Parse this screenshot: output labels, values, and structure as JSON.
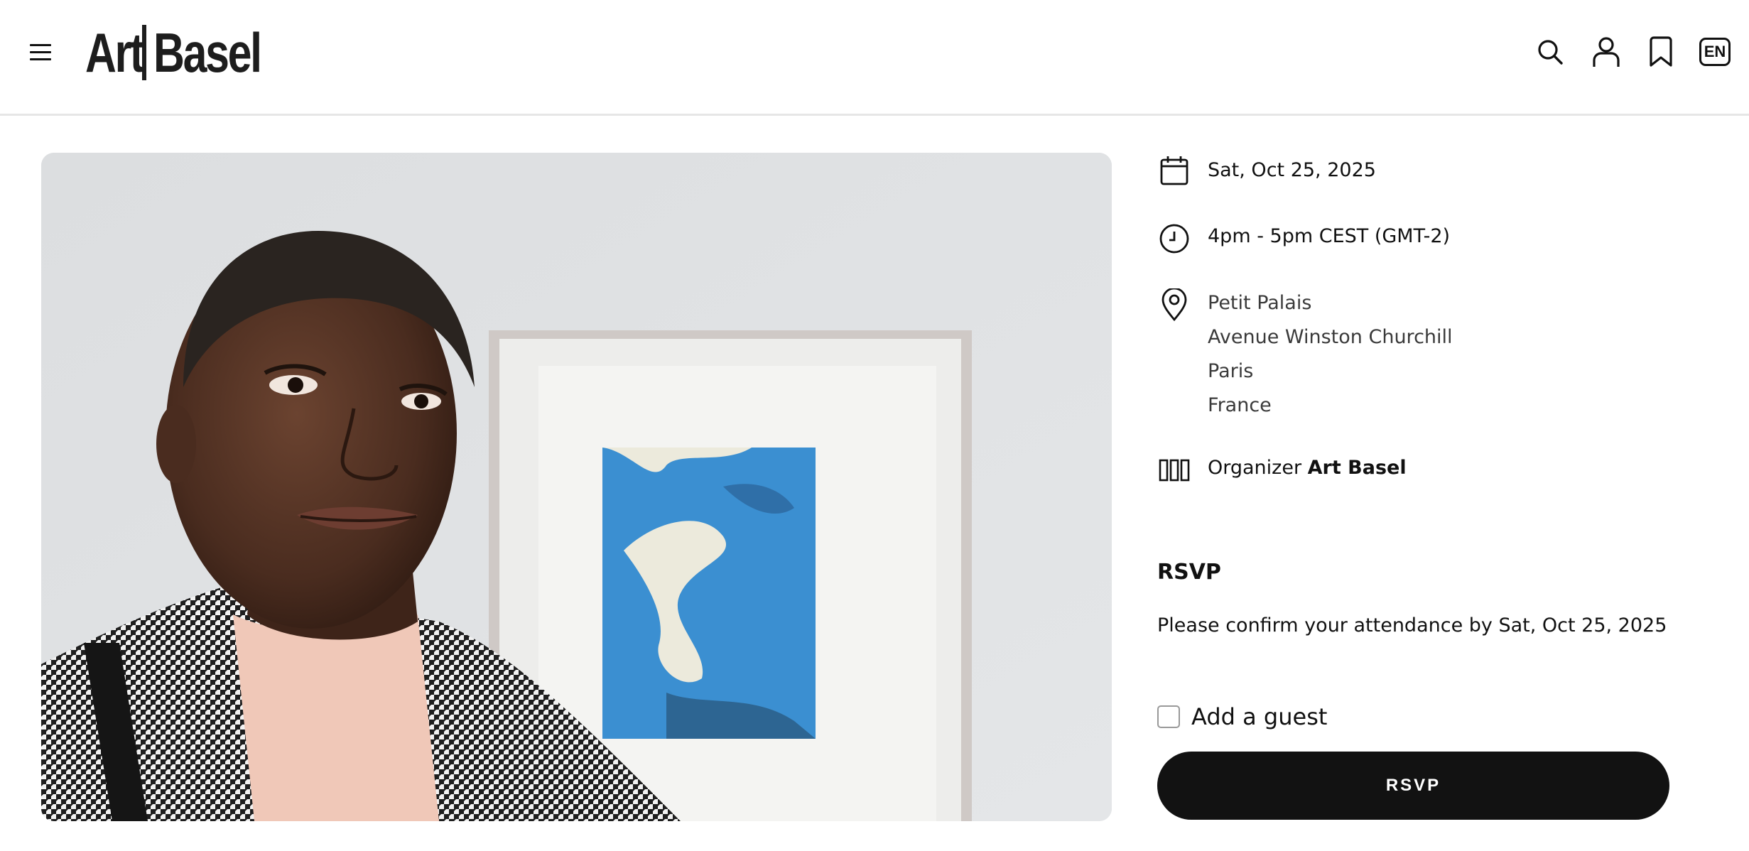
{
  "header": {
    "logo": {
      "word1": "Art",
      "word2": "Basel"
    },
    "language": "EN",
    "icons": [
      "menu-icon",
      "search-icon",
      "user-icon",
      "bookmark-icon"
    ]
  },
  "hero": {
    "image": "portrait-photo"
  },
  "event": {
    "date": "Sat, Oct 25, 2025",
    "time": "4pm - 5pm CEST (GMT-2)",
    "address": [
      "Petit Palais",
      "Avenue Winston Churchill",
      "Paris",
      "France"
    ],
    "organizer_label": "Organizer",
    "organizer_name": "Art Basel"
  },
  "rsvp": {
    "heading": "RSVP",
    "note": "Please confirm your attendance by Sat, Oct 25, 2025",
    "guest_label": "Add a guest",
    "guest_checked": false,
    "button_label": "RSVP"
  },
  "colors": {
    "accent": "#121212",
    "background": "#ffffff",
    "divider": "#e6e6e6"
  }
}
